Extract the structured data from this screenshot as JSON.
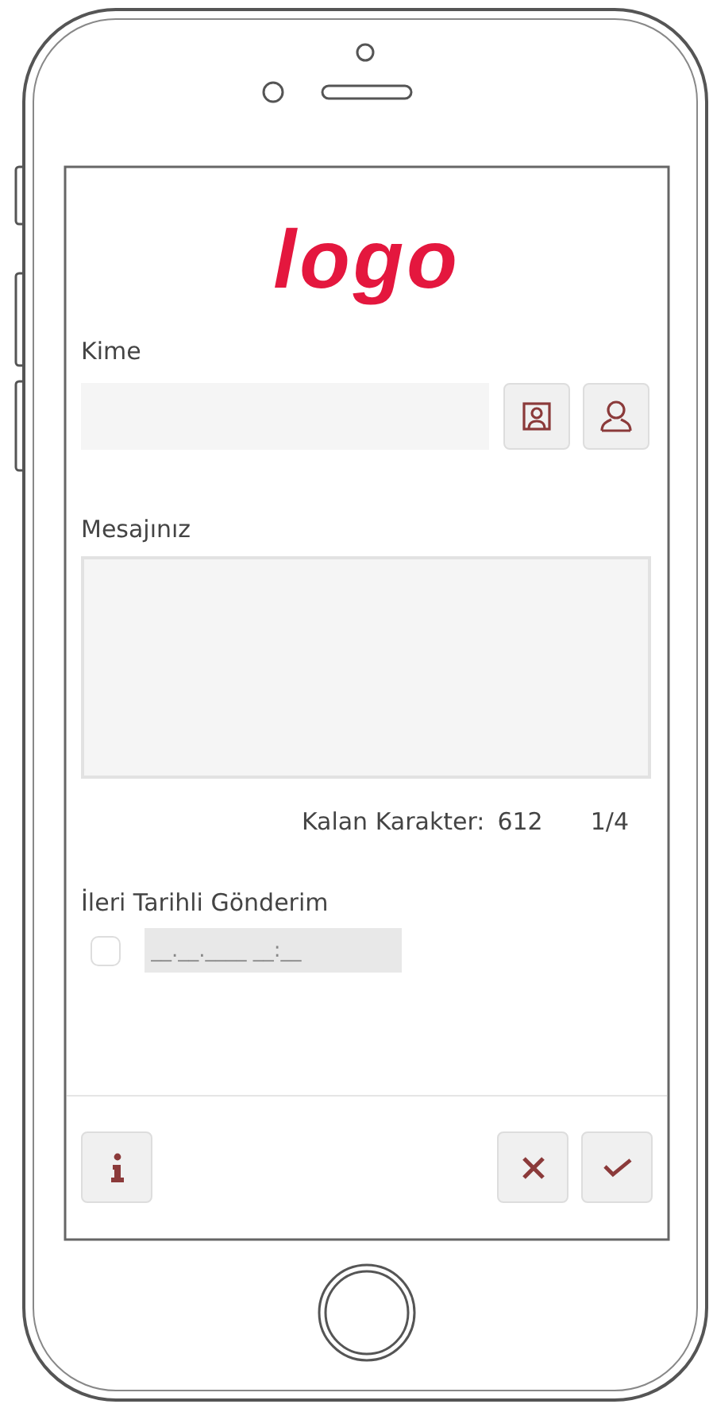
{
  "logo": {
    "text": "logo"
  },
  "recipient": {
    "label": "Kime"
  },
  "message": {
    "label": "Mesajınız"
  },
  "counter": {
    "label": "Kalan Karakter:",
    "remaining": "612",
    "page": "1/4"
  },
  "scheduled": {
    "label": "İleri Tarihli Gönderim",
    "checked": false,
    "placeholder": "__.__.____ __:__"
  }
}
